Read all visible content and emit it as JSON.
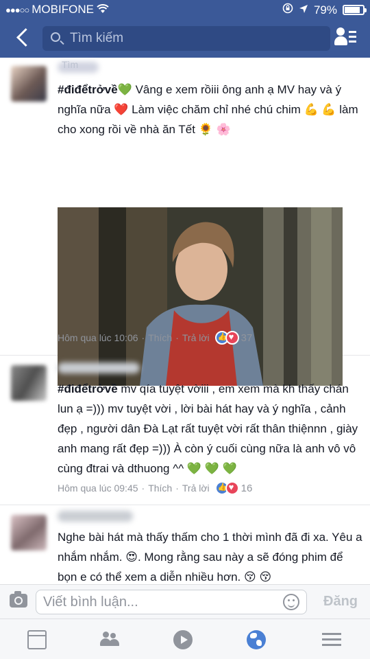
{
  "status": {
    "carrier": "MOBIFONE",
    "battery": "79%"
  },
  "header": {
    "search_placeholder": "Tìm kiếm"
  },
  "comments": [
    {
      "faded_label": "Tìm",
      "hashtag": "#điđểtrởvề",
      "text": "💚  Vâng e xem rồiii ông anh ạ MV hay và ý nghĩa nữa ❤️  Làm việc chăm chỉ nhé chú chim 💪 💪 làm cho xong rồi về nhà ăn Tết 🌻 🌸",
      "time": "Hôm qua lúc 10:06",
      "like": "Thích",
      "reply": "Trả lời",
      "reactions": "37"
    },
    {
      "hashtag": "#điđểtrởvề",
      "text": " mv qía tuyệt vờiii , em xem mà kh thấy chán lun ạ =))) mv tuyệt vời , lời bài hát hay và ý nghĩa , cảnh đẹp , người dân Đà Lạt rất tuyệt vời rất thân thiệnnn , giày anh mang rất đẹp =))) À còn ý cuối cùng nữa là anh vô vô cùng đtrai và dthuong ^^ 💚 💚 💚",
      "time": "Hôm qua lúc 09:45",
      "like": "Thích",
      "reply": "Trả lời",
      "reactions": "16"
    },
    {
      "text": "Nghe bài hát mà thấy thấm cho 1 thời mình đã đi xa. Yêu a nhắm nhắm. 😍. Mong rằng sau này a sẽ đóng phim để bọn e có thể xem a diễn nhiều hơn. 😚 😚"
    }
  ],
  "composer": {
    "placeholder": "Viết bình luận...",
    "post_label": "Đăng"
  },
  "colors": {
    "header_blue": "#3b5998",
    "meta_gray": "#90949c",
    "like_blue": "#4a80d4",
    "love_red": "#e8455a"
  }
}
